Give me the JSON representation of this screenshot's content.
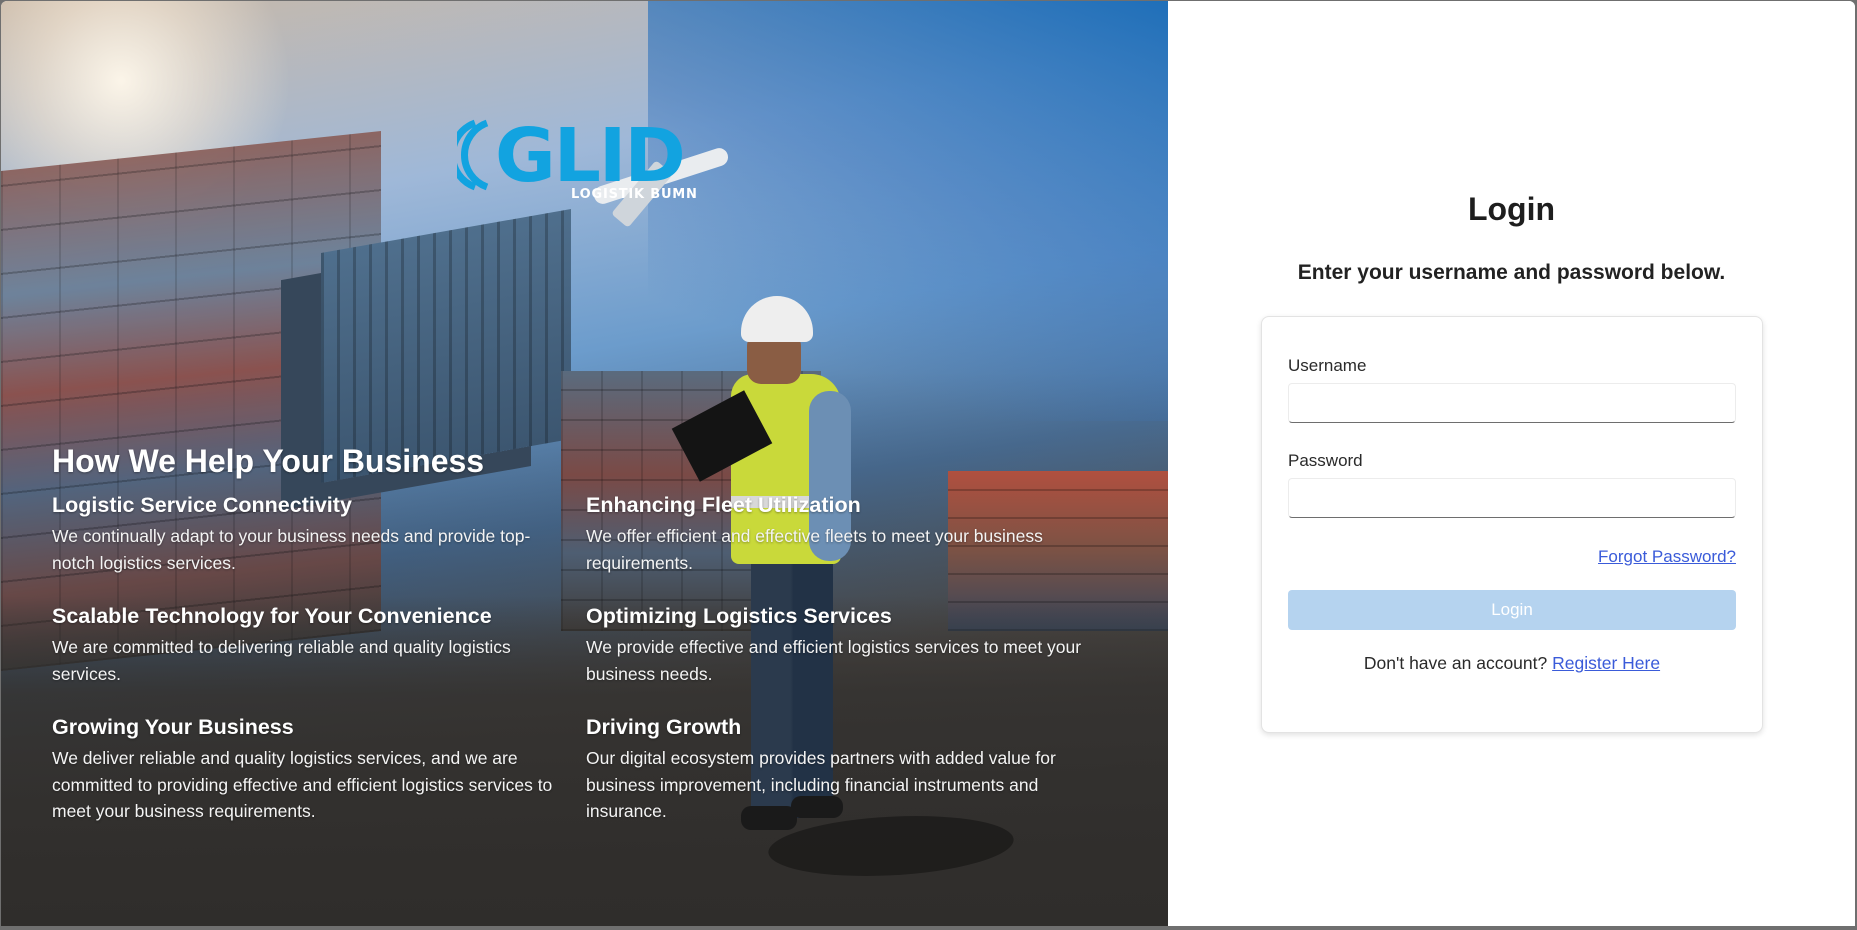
{
  "hero": {
    "logo": {
      "text": "GLID",
      "subtitle": "LOGISTIK BUMN",
      "color": "#12a3e0"
    },
    "title": "How We Help Your Business",
    "features": [
      {
        "title": "Logistic Service Connectivity",
        "description": "We continually adapt to your business needs and provide top-notch logistics services."
      },
      {
        "title": "Enhancing Fleet Utilization",
        "description": "We offer efficient and effective fleets to meet your business requirements."
      },
      {
        "title": "Scalable Technology for Your Convenience",
        "description": "We are committed to delivering reliable and quality logistics services."
      },
      {
        "title": "Optimizing Logistics Services",
        "description": "We provide effective and efficient logistics services to meet your business needs."
      },
      {
        "title": "Growing Your Business",
        "description": "We deliver reliable and quality logistics services, and we are committed to providing effective and efficient logistics services to meet your business requirements."
      },
      {
        "title": "Driving Growth",
        "description": "Our digital ecosystem provides partners with added value for business improvement, including financial instruments and insurance."
      }
    ]
  },
  "login": {
    "title": "Login",
    "subtitle": "Enter your username and password below.",
    "username_label": "Username",
    "username_value": "",
    "password_label": "Password",
    "password_value": "",
    "forgot_label": "Forgot Password?",
    "button_label": "Login",
    "register_prompt": "Don't have an account?",
    "register_link": "Register Here",
    "colors": {
      "button_bg": "#b5d3ef",
      "link": "#3a5bd9"
    }
  }
}
